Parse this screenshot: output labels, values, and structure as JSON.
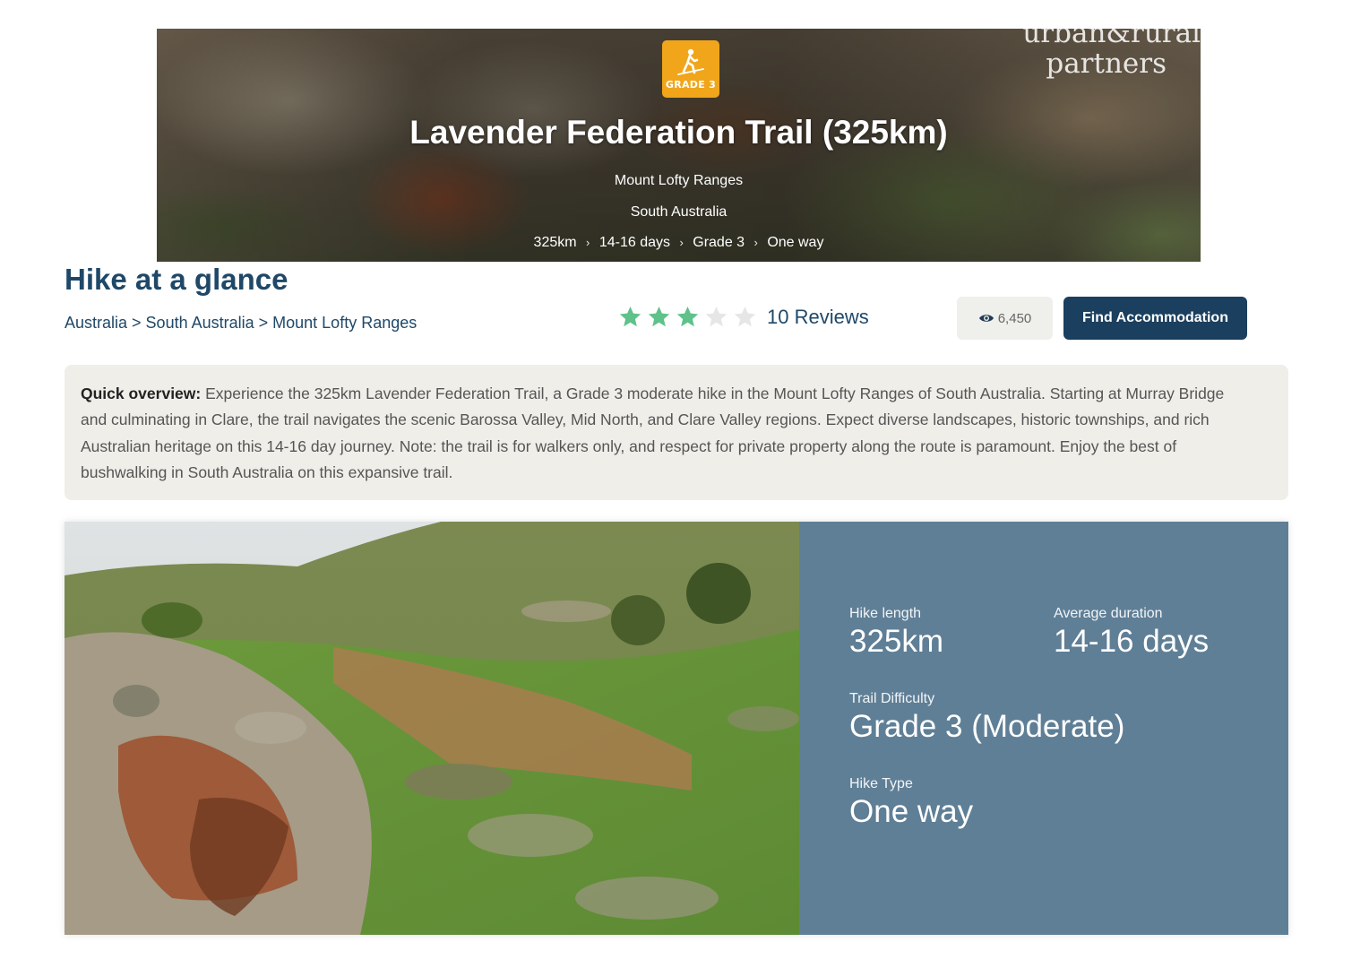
{
  "hero": {
    "grade_badge": "GRADE 3",
    "title": "Lavender Federation Trail (325km)",
    "region": "Mount Lofty Ranges",
    "state": "South Australia",
    "facts": [
      "325km",
      "14-16 days",
      "Grade 3",
      "One way"
    ],
    "watermark_line1": "urban&rural",
    "watermark_line2": "partners"
  },
  "glance": {
    "title": "Hike at a glance",
    "breadcrumb": [
      "Australia",
      "South Australia",
      "Mount Lofty Ranges"
    ],
    "breadcrumb_separator": ">",
    "rating": {
      "filled_stars": 3,
      "max_stars": 5
    },
    "reviews_label": "10 Reviews",
    "views": "6,450",
    "find_button": "Find Accommodation"
  },
  "overview": {
    "label": "Quick overview:",
    "text": "Experience the 325km Lavender Federation Trail, a Grade 3 moderate hike in the Mount Lofty Ranges of South Australia. Starting at Murray Bridge and culminating in Clare, the trail navigates the scenic Barossa Valley, Mid North, and Clare Valley regions. Expect diverse landscapes, historic townships, and rich Australian heritage on this 14-16 day journey. Note: the trail is for walkers only, and respect for private property along the route is paramount. Enjoy the best of bushwalking in South Australia on this expansive trail."
  },
  "stats": {
    "length_label": "Hike length",
    "length_value": "325km",
    "duration_label": "Average duration",
    "duration_value": "14-16 days",
    "difficulty_label": "Trail Difficulty",
    "difficulty_value": "Grade 3 (Moderate)",
    "type_label": "Hike Type",
    "type_value": "One way"
  },
  "colors": {
    "navy": "#1b3f5e",
    "heading_blue": "#1f4868",
    "star_filled": "#5ec28a",
    "star_empty": "#e6e6e6",
    "grade_badge": "#f0a51a",
    "stats_panel": "#5f7f96",
    "overview_bg": "#efeee9"
  },
  "icons": {
    "badge": "hiker-icon",
    "views": "eye-icon",
    "rating": "star-icon"
  }
}
